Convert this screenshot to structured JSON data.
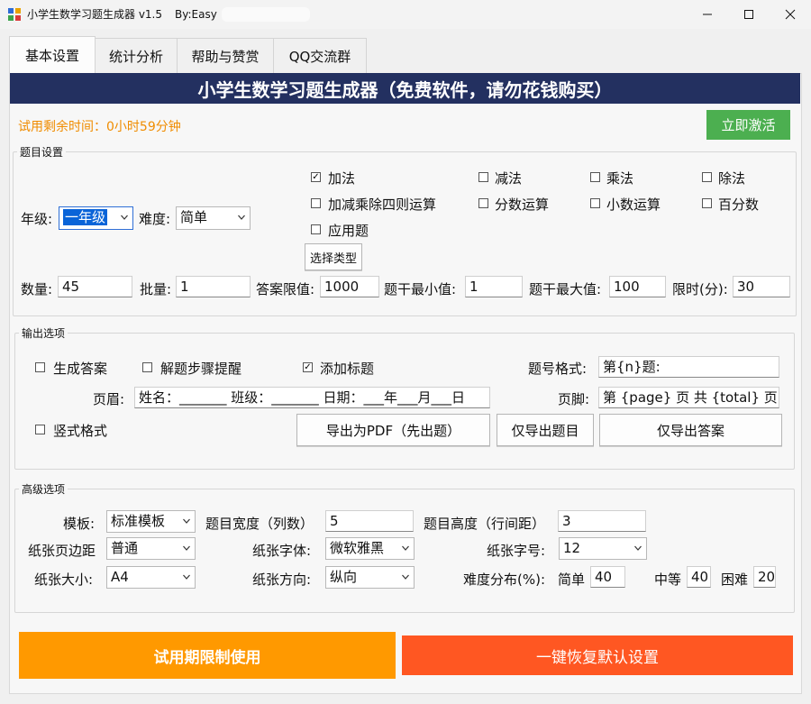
{
  "window": {
    "title": "小学生数学习题生成器 v1.5",
    "author": "By:Easy",
    "minimize_icon": "minimize-icon",
    "maximize_icon": "maximize-icon",
    "close_icon": "close-icon"
  },
  "tabs": [
    {
      "label": "基本设置",
      "active": true
    },
    {
      "label": "统计分析",
      "active": false
    },
    {
      "label": "帮助与赞赏",
      "active": false
    },
    {
      "label": "QQ交流群",
      "active": false
    }
  ],
  "banner": "小学生数学习题生成器（免费软件，请勿花钱购买）",
  "trial_remaining": "试用剩余时间：0小时59分钟",
  "activate_label": "立即激活",
  "colors": {
    "banner": "#233060",
    "trial_text": "#f08c00",
    "activate": "#4caf50",
    "trial_button": "#ff9900",
    "reset_button": "#ff5722"
  },
  "question_settings": {
    "group_label": "题目设置",
    "grade_label": "年级:",
    "grade_value": "一年级",
    "difficulty_label": "难度:",
    "difficulty_value": "简单",
    "types": [
      {
        "label": "加法",
        "checked": true
      },
      {
        "label": "减法",
        "checked": false
      },
      {
        "label": "乘法",
        "checked": false
      },
      {
        "label": "除法",
        "checked": false
      },
      {
        "label": "加减乘除四则运算",
        "checked": false
      },
      {
        "label": "分数运算",
        "checked": false
      },
      {
        "label": "小数运算",
        "checked": false
      },
      {
        "label": "百分数",
        "checked": false
      },
      {
        "label": "应用题",
        "checked": false
      }
    ],
    "select_type_label": "选择类型",
    "fields": [
      {
        "label": "数量:",
        "value": "45"
      },
      {
        "label": "批量:",
        "value": "1"
      },
      {
        "label": "答案限值:",
        "value": "1000"
      },
      {
        "label": "题干最小值:",
        "value": "1"
      },
      {
        "label": "题干最大值:",
        "value": "100"
      },
      {
        "label": "限时(分):",
        "value": "30"
      }
    ]
  },
  "output_options": {
    "group_label": "输出选项",
    "generate_answers": {
      "label": "生成答案",
      "checked": false
    },
    "step_hints": {
      "label": "解题步骤提醒",
      "checked": false
    },
    "add_title": {
      "label": "添加标题",
      "checked": true
    },
    "number_format_label": "题号格式:",
    "number_format_value": "第{n}题:",
    "header_label": "页眉:",
    "header_value": "姓名：_______  班级：_______  日期：___年___月___日",
    "footer_label": "页脚:",
    "footer_value": "第 {page} 页 共 {total} 页",
    "vertical_format": {
      "label": "竖式格式",
      "checked": false
    },
    "export_pdf_label": "导出为PDF（先出题）",
    "export_questions_label": "仅导出题目",
    "export_answers_label": "仅导出答案"
  },
  "advanced_options": {
    "group_label": "高级选项",
    "template_label": "模板:",
    "template_value": "标准模板",
    "question_width_label": "题目宽度（列数）",
    "question_width_value": "5",
    "question_height_label": "题目高度（行间距）",
    "question_height_value": "3",
    "margin_label": "纸张页边距",
    "margin_value": "普通",
    "font_label": "纸张字体:",
    "font_value": "微软雅黑",
    "font_size_label": "纸张字号:",
    "font_size_value": "12",
    "paper_size_label": "纸张大小:",
    "paper_size_value": "A4",
    "orientation_label": "纸张方向:",
    "orientation_value": "纵向",
    "distribution_label": "难度分布(%):",
    "easy_label": "简单",
    "easy_value": "40",
    "medium_label": "中等",
    "medium_value": "40",
    "hard_label": "困难",
    "hard_value": "20"
  },
  "trial_button_label": "试用期限制使用",
  "reset_button_label": "一键恢复默认设置"
}
